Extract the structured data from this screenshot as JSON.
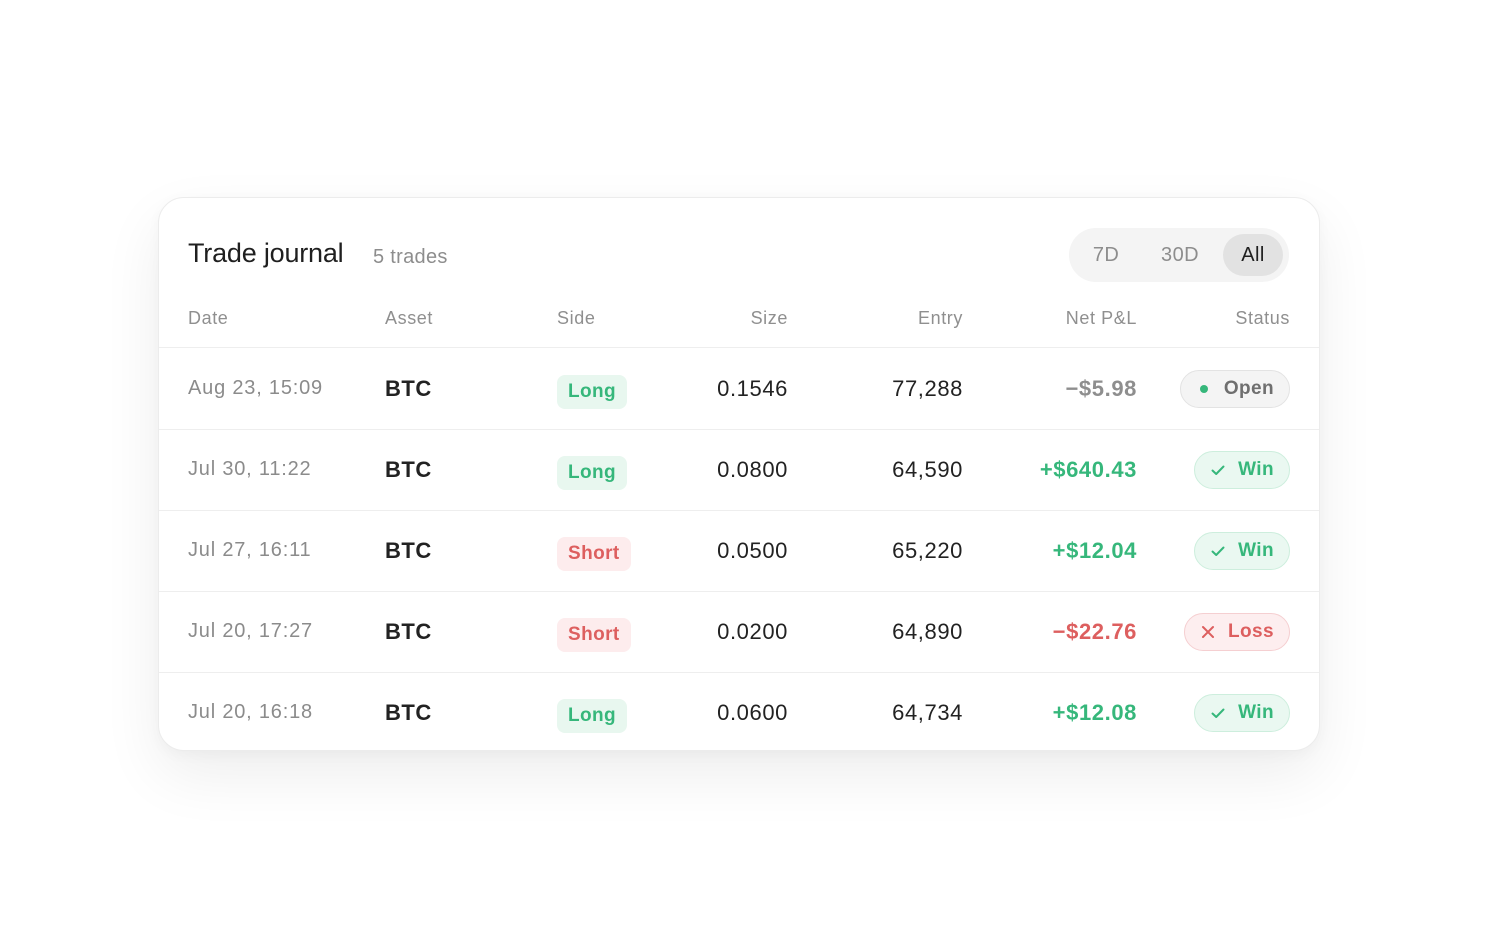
{
  "journal": {
    "title": "Trade journal",
    "count": "5 trades",
    "ranges": [
      "7D",
      "30D",
      "All"
    ],
    "active_range": "All"
  },
  "columns": {
    "date": "Date",
    "asset": "Asset",
    "side": "Side",
    "size": "Size",
    "entry": "Entry",
    "pnl": "Net P&L",
    "status": "Status"
  },
  "trades": [
    {
      "date": "Aug 23, 15:09",
      "asset": "BTC",
      "side": "Long",
      "size": "0.1546",
      "entry": "77,288",
      "pnl": "−$5.98",
      "status": "Open"
    },
    {
      "date": "Jul 30, 11:22",
      "asset": "BTC",
      "side": "Long",
      "size": "0.0800",
      "entry": "64,590",
      "pnl": "+$640.43",
      "status": "Win"
    },
    {
      "date": "Jul 27, 16:11",
      "asset": "BTC",
      "side": "Short",
      "size": "0.0500",
      "entry": "65,220",
      "pnl": "+$12.04",
      "status": "Win"
    },
    {
      "date": "Jul 20, 17:27",
      "asset": "BTC",
      "side": "Short",
      "size": "0.0200",
      "entry": "64,890",
      "pnl": "−$22.76",
      "status": "Loss"
    },
    {
      "date": "Jul 20, 16:18",
      "asset": "BTC",
      "side": "Long",
      "size": "0.0600",
      "entry": "64,734",
      "pnl": "+$12.08",
      "status": "Win"
    }
  ],
  "colors": {
    "positive": "#36b77b",
    "negative": "#dd5f5f",
    "neutral": "#8e8e8e"
  },
  "icons": {
    "open": "dot-icon",
    "win": "check-icon",
    "loss": "x-icon"
  }
}
